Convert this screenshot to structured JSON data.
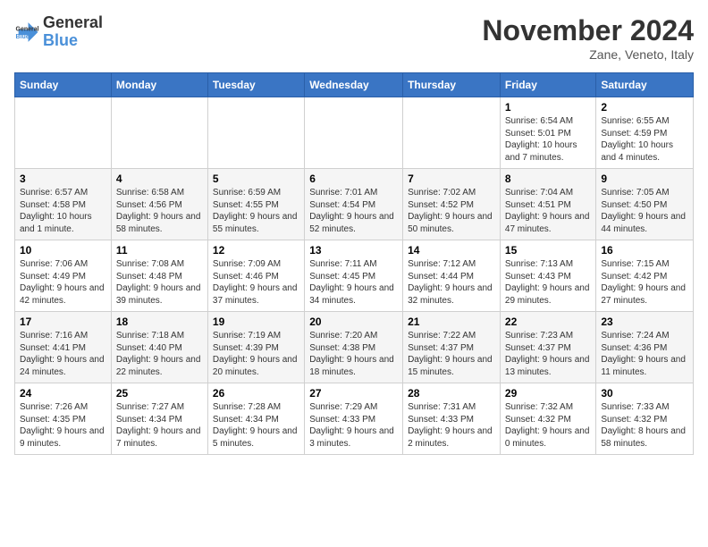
{
  "header": {
    "logo_line1": "General",
    "logo_line2": "Blue",
    "month": "November 2024",
    "location": "Zane, Veneto, Italy"
  },
  "weekdays": [
    "Sunday",
    "Monday",
    "Tuesday",
    "Wednesday",
    "Thursday",
    "Friday",
    "Saturday"
  ],
  "weeks": [
    [
      {
        "num": "",
        "info": ""
      },
      {
        "num": "",
        "info": ""
      },
      {
        "num": "",
        "info": ""
      },
      {
        "num": "",
        "info": ""
      },
      {
        "num": "",
        "info": ""
      },
      {
        "num": "1",
        "info": "Sunrise: 6:54 AM\nSunset: 5:01 PM\nDaylight: 10 hours and 7 minutes."
      },
      {
        "num": "2",
        "info": "Sunrise: 6:55 AM\nSunset: 4:59 PM\nDaylight: 10 hours and 4 minutes."
      }
    ],
    [
      {
        "num": "3",
        "info": "Sunrise: 6:57 AM\nSunset: 4:58 PM\nDaylight: 10 hours and 1 minute."
      },
      {
        "num": "4",
        "info": "Sunrise: 6:58 AM\nSunset: 4:56 PM\nDaylight: 9 hours and 58 minutes."
      },
      {
        "num": "5",
        "info": "Sunrise: 6:59 AM\nSunset: 4:55 PM\nDaylight: 9 hours and 55 minutes."
      },
      {
        "num": "6",
        "info": "Sunrise: 7:01 AM\nSunset: 4:54 PM\nDaylight: 9 hours and 52 minutes."
      },
      {
        "num": "7",
        "info": "Sunrise: 7:02 AM\nSunset: 4:52 PM\nDaylight: 9 hours and 50 minutes."
      },
      {
        "num": "8",
        "info": "Sunrise: 7:04 AM\nSunset: 4:51 PM\nDaylight: 9 hours and 47 minutes."
      },
      {
        "num": "9",
        "info": "Sunrise: 7:05 AM\nSunset: 4:50 PM\nDaylight: 9 hours and 44 minutes."
      }
    ],
    [
      {
        "num": "10",
        "info": "Sunrise: 7:06 AM\nSunset: 4:49 PM\nDaylight: 9 hours and 42 minutes."
      },
      {
        "num": "11",
        "info": "Sunrise: 7:08 AM\nSunset: 4:48 PM\nDaylight: 9 hours and 39 minutes."
      },
      {
        "num": "12",
        "info": "Sunrise: 7:09 AM\nSunset: 4:46 PM\nDaylight: 9 hours and 37 minutes."
      },
      {
        "num": "13",
        "info": "Sunrise: 7:11 AM\nSunset: 4:45 PM\nDaylight: 9 hours and 34 minutes."
      },
      {
        "num": "14",
        "info": "Sunrise: 7:12 AM\nSunset: 4:44 PM\nDaylight: 9 hours and 32 minutes."
      },
      {
        "num": "15",
        "info": "Sunrise: 7:13 AM\nSunset: 4:43 PM\nDaylight: 9 hours and 29 minutes."
      },
      {
        "num": "16",
        "info": "Sunrise: 7:15 AM\nSunset: 4:42 PM\nDaylight: 9 hours and 27 minutes."
      }
    ],
    [
      {
        "num": "17",
        "info": "Sunrise: 7:16 AM\nSunset: 4:41 PM\nDaylight: 9 hours and 24 minutes."
      },
      {
        "num": "18",
        "info": "Sunrise: 7:18 AM\nSunset: 4:40 PM\nDaylight: 9 hours and 22 minutes."
      },
      {
        "num": "19",
        "info": "Sunrise: 7:19 AM\nSunset: 4:39 PM\nDaylight: 9 hours and 20 minutes."
      },
      {
        "num": "20",
        "info": "Sunrise: 7:20 AM\nSunset: 4:38 PM\nDaylight: 9 hours and 18 minutes."
      },
      {
        "num": "21",
        "info": "Sunrise: 7:22 AM\nSunset: 4:37 PM\nDaylight: 9 hours and 15 minutes."
      },
      {
        "num": "22",
        "info": "Sunrise: 7:23 AM\nSunset: 4:37 PM\nDaylight: 9 hours and 13 minutes."
      },
      {
        "num": "23",
        "info": "Sunrise: 7:24 AM\nSunset: 4:36 PM\nDaylight: 9 hours and 11 minutes."
      }
    ],
    [
      {
        "num": "24",
        "info": "Sunrise: 7:26 AM\nSunset: 4:35 PM\nDaylight: 9 hours and 9 minutes."
      },
      {
        "num": "25",
        "info": "Sunrise: 7:27 AM\nSunset: 4:34 PM\nDaylight: 9 hours and 7 minutes."
      },
      {
        "num": "26",
        "info": "Sunrise: 7:28 AM\nSunset: 4:34 PM\nDaylight: 9 hours and 5 minutes."
      },
      {
        "num": "27",
        "info": "Sunrise: 7:29 AM\nSunset: 4:33 PM\nDaylight: 9 hours and 3 minutes."
      },
      {
        "num": "28",
        "info": "Sunrise: 7:31 AM\nSunset: 4:33 PM\nDaylight: 9 hours and 2 minutes."
      },
      {
        "num": "29",
        "info": "Sunrise: 7:32 AM\nSunset: 4:32 PM\nDaylight: 9 hours and 0 minutes."
      },
      {
        "num": "30",
        "info": "Sunrise: 7:33 AM\nSunset: 4:32 PM\nDaylight: 8 hours and 58 minutes."
      }
    ]
  ]
}
